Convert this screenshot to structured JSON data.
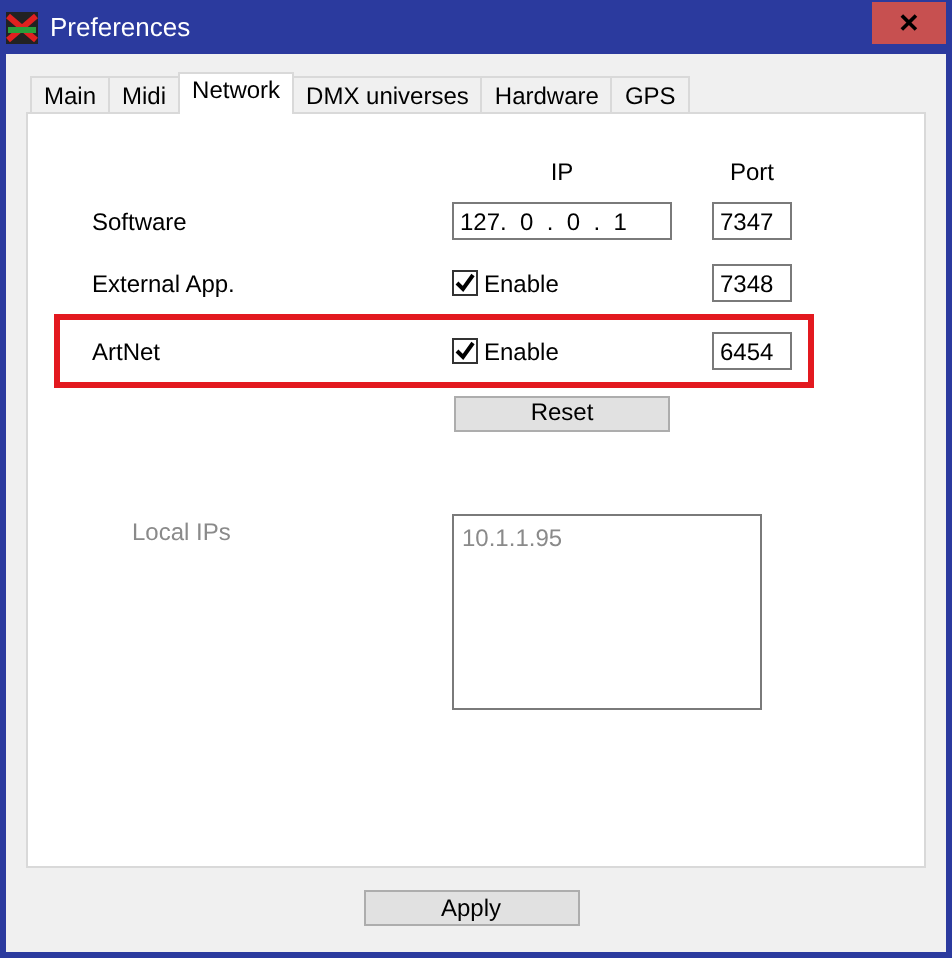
{
  "window": {
    "title": "Preferences",
    "close_button": "✕"
  },
  "tabs": [
    {
      "label": "Main",
      "selected": false
    },
    {
      "label": "Midi",
      "selected": false
    },
    {
      "label": "Network",
      "selected": true
    },
    {
      "label": "DMX universes",
      "selected": false
    },
    {
      "label": "Hardware",
      "selected": false
    },
    {
      "label": "GPS",
      "selected": false
    }
  ],
  "network": {
    "column_headers": [
      "IP",
      "Port"
    ],
    "rows": [
      {
        "label": "Software",
        "kind": "ip",
        "ip": "127.  0  .  0  .  1",
        "port": "7347",
        "highlighted": false
      },
      {
        "label": "External App.",
        "kind": "checkbox",
        "checkbox_label": "Enable",
        "checked": true,
        "port": "7348",
        "highlighted": false
      },
      {
        "label": "ArtNet",
        "kind": "checkbox",
        "checkbox_label": "Enable",
        "checked": true,
        "port": "6454",
        "highlighted": true
      }
    ],
    "reset_button": "Reset",
    "local_ips": {
      "label": "Local IPs",
      "disabled": true,
      "items": [
        "10.1.1.95"
      ]
    }
  },
  "apply_button": "Apply"
}
